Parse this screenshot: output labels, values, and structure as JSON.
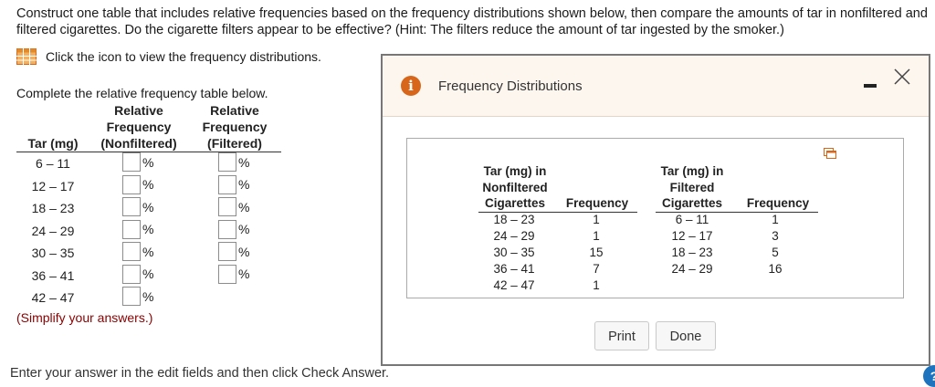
{
  "question": "Construct one table that includes relative frequencies based on the frequency distributions shown below, then compare the amounts of tar in nonfiltered and filtered cigarettes. Do the cigarette filters appear to be effective? (Hint: The filters reduce the amount of tar ingested by the smoker.)",
  "icon_link_text": "Click the icon to view the frequency distributions.",
  "instruction": "Complete the relative frequency table below.",
  "table": {
    "headers": {
      "tar": "Tar (mg)",
      "rel1_line1": "Relative",
      "rel1_line2": "Frequency",
      "rel1_line3": "(Nonfiltered)",
      "rel2_line1": "Relative",
      "rel2_line2": "Frequency",
      "rel2_line3": "(Filtered)"
    },
    "rows": [
      {
        "tar": "6 – 11",
        "nonfiltered": "",
        "filtered": ""
      },
      {
        "tar": "12 – 17",
        "nonfiltered": "",
        "filtered": ""
      },
      {
        "tar": "18 – 23",
        "nonfiltered": "",
        "filtered": ""
      },
      {
        "tar": "24 – 29",
        "nonfiltered": "",
        "filtered": ""
      },
      {
        "tar": "30 – 35",
        "nonfiltered": "",
        "filtered": ""
      },
      {
        "tar": "36 – 41",
        "nonfiltered": "",
        "filtered": ""
      },
      {
        "tar": "42 – 47",
        "nonfiltered": "",
        "filtered": null
      }
    ],
    "percent_sign": "%"
  },
  "simplify_note": "(Simplify your answers.)",
  "bottom_message": "Enter your answer in the edit fields and then click Check Answer.",
  "help_label": "?",
  "modal": {
    "title": "Frequency Distributions",
    "info_glyph": "i",
    "close_glyph": "╳",
    "nonfiltered": {
      "header_line1": "Tar (mg) in",
      "header_line2": "Nonfiltered",
      "header_line3": "Cigarettes",
      "freq_header": "Frequency",
      "classes": [
        "18 – 23",
        "24 – 29",
        "30 – 35",
        "36 – 41",
        "42 – 47"
      ],
      "frequencies": [
        "1",
        "1",
        "15",
        "7",
        "1"
      ]
    },
    "filtered": {
      "header_line1": "Tar (mg) in",
      "header_line2": "Filtered",
      "header_line3": "Cigarettes",
      "freq_header": "Frequency",
      "classes": [
        "6 – 11",
        "12 – 17",
        "18 – 23",
        "24 – 29"
      ],
      "frequencies": [
        "1",
        "3",
        "5",
        "16"
      ]
    },
    "print_label": "Print",
    "done_label": "Done"
  },
  "colors": {
    "accent_orange": "#d8661a",
    "header_bg": "#fdf6ee",
    "note_red": "#8b0000",
    "help_blue": "#1e73be"
  }
}
